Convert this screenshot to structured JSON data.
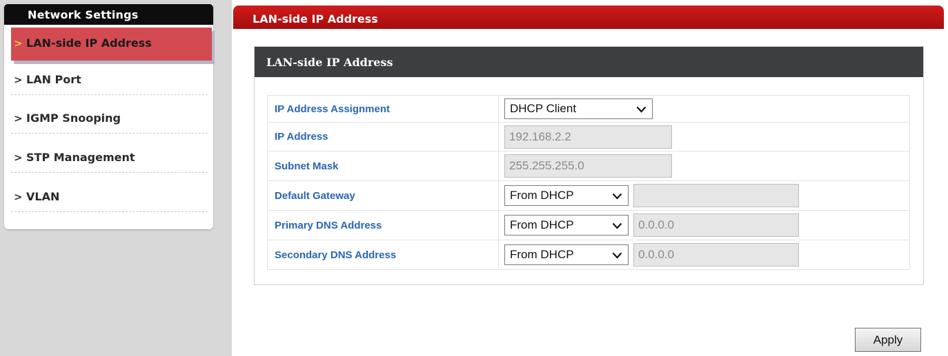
{
  "sidebar": {
    "header": "Network Settings",
    "items": [
      {
        "label": "LAN-side IP Address",
        "active": true
      },
      {
        "label": "LAN Port"
      },
      {
        "label": "IGMP Snooping"
      },
      {
        "label": "STP Management"
      },
      {
        "label": "VLAN"
      }
    ]
  },
  "page": {
    "header": "LAN-side IP Address",
    "panel_title": "LAN-side IP Address"
  },
  "form": {
    "ip_assignment": {
      "label": "IP Address Assignment",
      "value": "DHCP Client"
    },
    "ip_address": {
      "label": "IP Address",
      "value": "192.168.2.2"
    },
    "subnet_mask": {
      "label": "Subnet Mask",
      "value": "255.255.255.0"
    },
    "default_gateway": {
      "label": "Default Gateway",
      "mode": "From DHCP",
      "value": ""
    },
    "primary_dns": {
      "label": "Primary DNS Address",
      "mode": "From DHCP",
      "value": "0.0.0.0"
    },
    "secondary_dns": {
      "label": "Secondary DNS Address",
      "mode": "From DHCP",
      "value": "0.0.0.0"
    }
  },
  "actions": {
    "apply_label": "Apply"
  },
  "icons": {
    "nav_arrow": "chevron-right-icon",
    "select_arrow": "chevron-down-icon"
  },
  "colors": {
    "header_red": "#c0161b",
    "active_item": "#d24b52",
    "active_arrow": "#f0c04c",
    "label_blue": "#2966b4",
    "panel_title_bg": "#3c3f3f"
  }
}
